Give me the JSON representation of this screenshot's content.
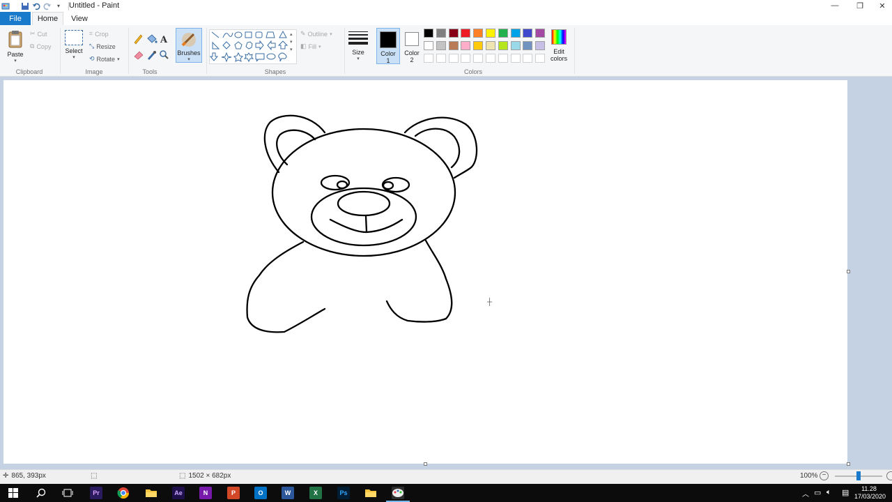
{
  "window": {
    "title": "Untitled - Paint",
    "minimize": "—",
    "restore": "❐",
    "close": "✕"
  },
  "tabs": {
    "file": "File",
    "home": "Home",
    "view": "View"
  },
  "ribbon": {
    "clipboard": {
      "paste": "Paste",
      "cut": "Cut",
      "copy": "Copy",
      "group": "Clipboard"
    },
    "image": {
      "select": "Select",
      "crop": "Crop",
      "resize": "Resize",
      "rotate": "Rotate",
      "group": "Image"
    },
    "tools": {
      "group": "Tools"
    },
    "brushes": {
      "label": "Brushes"
    },
    "shapes": {
      "outline": "Outline",
      "fill": "Fill",
      "group": "Shapes"
    },
    "size": {
      "label": "Size"
    },
    "color1": {
      "label": "Color",
      "num": "1",
      "color": "#000000"
    },
    "color2": {
      "label": "Color",
      "num": "2",
      "color": "#ffffff"
    },
    "colors": {
      "group": "Colors",
      "edit_label_1": "Edit",
      "edit_label_2": "colors",
      "row1": [
        "#000000",
        "#7f7f7f",
        "#880015",
        "#ed1c24",
        "#ff7f27",
        "#fff200",
        "#22b14c",
        "#00a2e8",
        "#3f48cc",
        "#a349a4"
      ],
      "row2": [
        "#ffffff",
        "#c3c3c3",
        "#b97a57",
        "#ffaec9",
        "#ffc90e",
        "#efe4b0",
        "#b5e61d",
        "#99d9ea",
        "#7092be",
        "#c8bfe7"
      ]
    }
  },
  "status": {
    "cursor_pos": "865, 393px",
    "image_size": "1502 × 682px",
    "zoom": "100%"
  },
  "zoom_slider": {
    "level_fraction": 0.5
  },
  "taskbar": {
    "clock_time": "11.28",
    "clock_date": "17/03/2020",
    "apps": [
      {
        "name": "premiere",
        "label": "Pr",
        "color": "#2a1a5e",
        "fg": "#d9a0ff"
      },
      {
        "name": "chrome",
        "label": "",
        "color": "#0c0c0c",
        "fg": "#fff"
      },
      {
        "name": "explorer",
        "label": "",
        "color": "#0c0c0c",
        "fg": "#fff"
      },
      {
        "name": "after-effects",
        "label": "Ae",
        "color": "#1f0f4a",
        "fg": "#c9a5ff"
      },
      {
        "name": "onenote",
        "label": "N",
        "color": "#7719aa",
        "fg": "#fff"
      },
      {
        "name": "powerpoint",
        "label": "P",
        "color": "#d24726",
        "fg": "#fff"
      },
      {
        "name": "outlook",
        "label": "O",
        "color": "#0072c6",
        "fg": "#fff"
      },
      {
        "name": "word",
        "label": "W",
        "color": "#2b579a",
        "fg": "#fff"
      },
      {
        "name": "excel",
        "label": "X",
        "color": "#217346",
        "fg": "#fff"
      },
      {
        "name": "photoshop",
        "label": "Ps",
        "color": "#001d34",
        "fg": "#31a8ff"
      },
      {
        "name": "folder",
        "label": "",
        "color": "#0c0c0c",
        "fg": "#fff"
      },
      {
        "name": "paint",
        "label": "",
        "color": "#2d2d2d",
        "fg": "#fff"
      }
    ]
  }
}
